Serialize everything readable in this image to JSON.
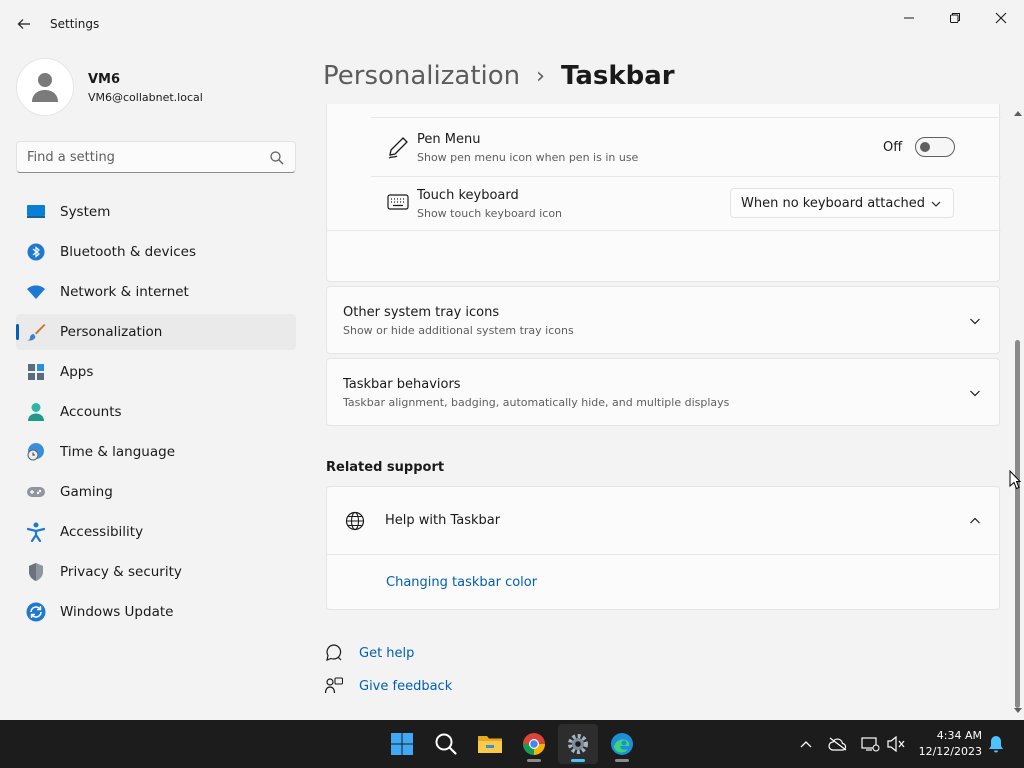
{
  "window": {
    "title": "Settings"
  },
  "profile": {
    "name": "VM6",
    "email": "VM6@collabnet.local"
  },
  "search": {
    "placeholder": "Find a setting"
  },
  "sidebar": {
    "items": [
      {
        "label": "System",
        "icon": "system-icon"
      },
      {
        "label": "Bluetooth & devices",
        "icon": "bluetooth-icon"
      },
      {
        "label": "Network & internet",
        "icon": "wifi-icon"
      },
      {
        "label": "Personalization",
        "icon": "brush-icon",
        "active": true
      },
      {
        "label": "Apps",
        "icon": "apps-icon"
      },
      {
        "label": "Accounts",
        "icon": "accounts-icon"
      },
      {
        "label": "Time & language",
        "icon": "time-language-icon"
      },
      {
        "label": "Gaming",
        "icon": "gamepad-icon"
      },
      {
        "label": "Accessibility",
        "icon": "accessibility-icon"
      },
      {
        "label": "Privacy & security",
        "icon": "shield-icon"
      },
      {
        "label": "Windows Update",
        "icon": "windows-update-icon"
      }
    ]
  },
  "breadcrumb": {
    "parent": "Personalization",
    "separator": "›",
    "current": "Taskbar"
  },
  "pen_menu": {
    "title": "Pen Menu",
    "subtitle": "Show pen menu icon when pen is in use",
    "state_label": "Off",
    "on": false
  },
  "touch_keyboard": {
    "title": "Touch keyboard",
    "subtitle": "Show touch keyboard icon",
    "selected": "When no keyboard attached"
  },
  "other_tray": {
    "title": "Other system tray icons",
    "subtitle": "Show or hide additional system tray icons"
  },
  "behaviors": {
    "title": "Taskbar behaviors",
    "subtitle": "Taskbar alignment, badging, automatically hide, and multiple displays"
  },
  "related": {
    "heading": "Related support",
    "help_title": "Help with Taskbar",
    "link": "Changing taskbar color"
  },
  "footer": {
    "get_help": "Get help",
    "give_feedback": "Give feedback"
  },
  "taskbar": {
    "apps": [
      "start-icon",
      "search-icon",
      "file-explorer-icon",
      "chrome-icon",
      "settings-icon",
      "edge-icon"
    ],
    "time": "4:34 AM",
    "date": "12/12/2023"
  },
  "colors": {
    "accent": "#005fb8",
    "taskbar": "#1c1c1c"
  }
}
